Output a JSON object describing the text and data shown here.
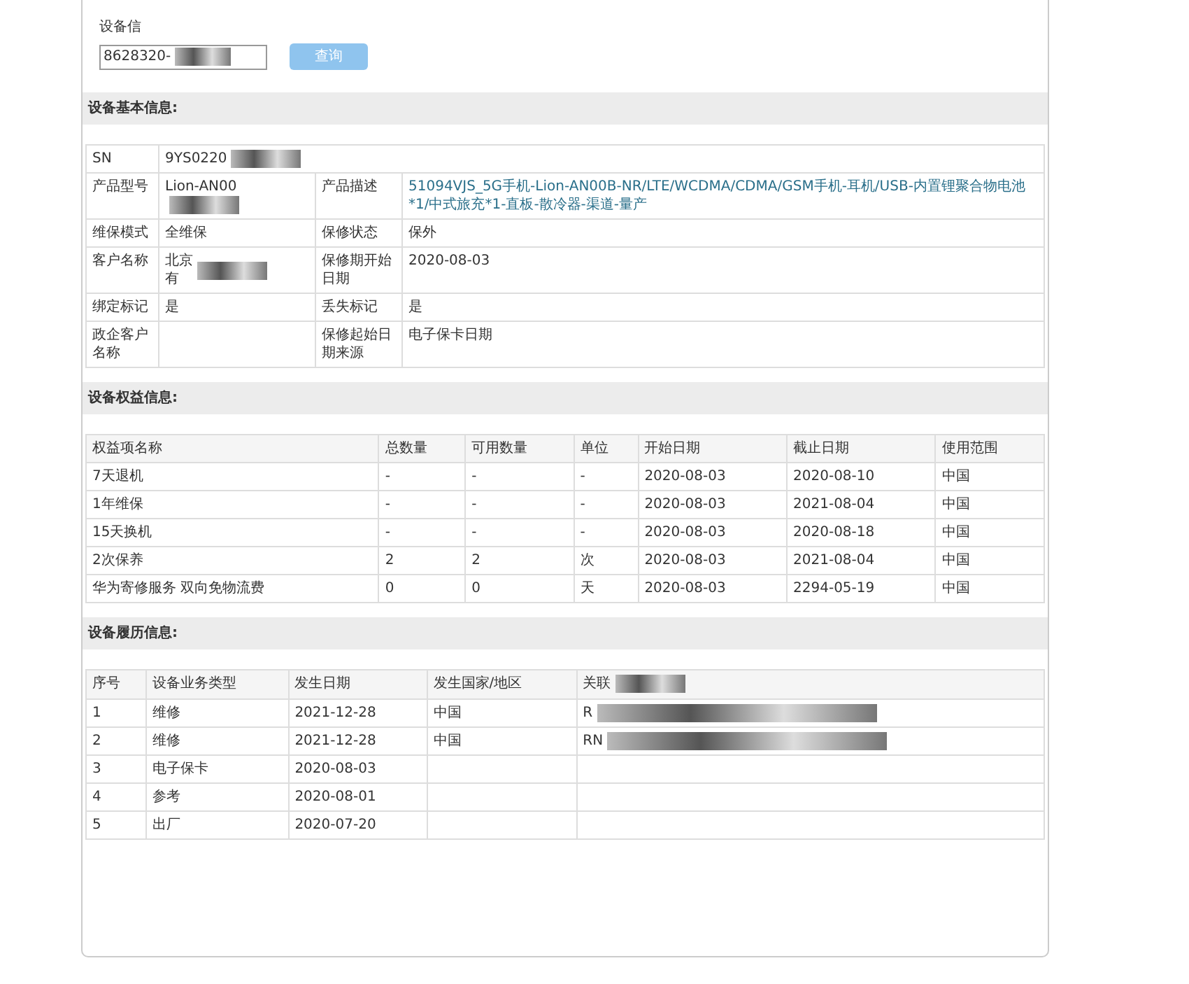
{
  "query": {
    "label": "设备信",
    "value": "8628320-",
    "redacted": true,
    "button": "查询"
  },
  "basic_info": {
    "title": "设备基本信息:",
    "rows": [
      [
        {
          "label": "SN",
          "value": "9YS0220",
          "redacted": true,
          "full": true
        }
      ],
      [
        {
          "label": "产品型号",
          "value": "Lion-AN00",
          "redacted": true
        },
        {
          "label": "产品描述",
          "value": "51094VJS_5G手机-Lion-AN00B-NR/LTE/WCDMA/CDMA/GSM手机-耳机/USB-内置锂聚合物电池*1/中式旅充*1-直板-散冷器-渠道-量产",
          "link": true
        }
      ],
      [
        {
          "label": "维保模式",
          "value": "全维保"
        },
        {
          "label": "保修状态",
          "value": "保外"
        }
      ],
      [
        {
          "label": "客户名称",
          "lines": [
            "北京",
            "有"
          ],
          "redacted": true
        },
        {
          "label": "保修期开始日期",
          "value": "2020-08-03"
        }
      ],
      [
        {
          "label": "绑定标记",
          "value": "是"
        },
        {
          "label": "丢失标记",
          "value": "是"
        }
      ],
      [
        {
          "label": "政企客户名称"
        },
        {
          "label": "保修起始日期来源",
          "value": "电子保卡日期"
        }
      ]
    ]
  },
  "rights": {
    "title": "设备权益信息:",
    "columns": [
      "权益项名称",
      "总数量",
      "可用数量",
      "单位",
      "开始日期",
      "截止日期",
      "使用范围"
    ],
    "rows": [
      [
        "7天退机",
        "-",
        "-",
        "-",
        "2020-08-03",
        "2020-08-10",
        "中国"
      ],
      [
        "1年维保",
        "-",
        "-",
        "-",
        "2020-08-03",
        "2021-08-04",
        "中国"
      ],
      [
        "15天换机",
        "-",
        "-",
        "-",
        "2020-08-03",
        "2020-08-18",
        "中国"
      ],
      [
        "2次保养",
        "2",
        "2",
        "次",
        "2020-08-03",
        "2021-08-04",
        "中国"
      ],
      [
        "华为寄修服务 双向免物流费",
        "0",
        "0",
        "天",
        "2020-08-03",
        "2294-05-19",
        "中国"
      ]
    ]
  },
  "history": {
    "title": "设备履历信息:",
    "columns": [
      "序号",
      "设备业务类型",
      "发生日期",
      "发生国家/地区",
      "关联"
    ],
    "redacted_column": true,
    "rows": [
      [
        "1",
        "维修",
        "2021-12-28",
        "中国",
        "R"
      ],
      [
        "2",
        "维修",
        "2021-12-28",
        "中国",
        "RN"
      ],
      [
        "3",
        "电子保卡",
        "2020-08-03",
        "",
        ""
      ],
      [
        "4",
        "参考",
        "2020-08-01",
        "",
        ""
      ],
      [
        "5",
        "出厂",
        "2020-07-20",
        "",
        ""
      ]
    ]
  }
}
